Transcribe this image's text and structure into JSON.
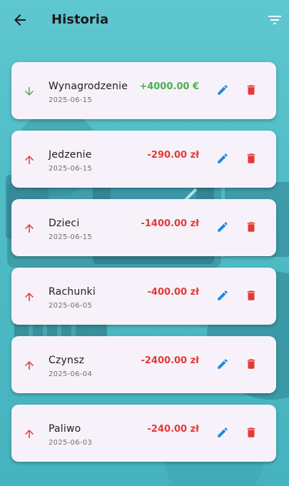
{
  "header": {
    "title": "Historia",
    "back_icon": "arrow-back-icon",
    "filter_icon": "filter-list-icon"
  },
  "colors": {
    "income": "#4caf50",
    "expense": "#e53935",
    "edit": "#1e88e5",
    "delete": "#e53935",
    "card_bg": "#f7f2fa"
  },
  "transactions": [
    {
      "name": "Wynagrodzenie",
      "date": "2025-06-15",
      "amount": "+4000.00 €",
      "type": "income"
    },
    {
      "name": "Jedzenie",
      "date": "2025-06-15",
      "amount": "-290.00 zł",
      "type": "expense"
    },
    {
      "name": "Dzieci",
      "date": "2025-06-15",
      "amount": "-1400.00 zł",
      "type": "expense"
    },
    {
      "name": "Rachunki",
      "date": "2025-06-05",
      "amount": "-400.00 zł",
      "type": "expense"
    },
    {
      "name": "Czynsz",
      "date": "2025-06-04",
      "amount": "-2400.00 zł",
      "type": "expense"
    },
    {
      "name": "Paliwo",
      "date": "2025-06-03",
      "amount": "-240.00 zł",
      "type": "expense"
    }
  ]
}
